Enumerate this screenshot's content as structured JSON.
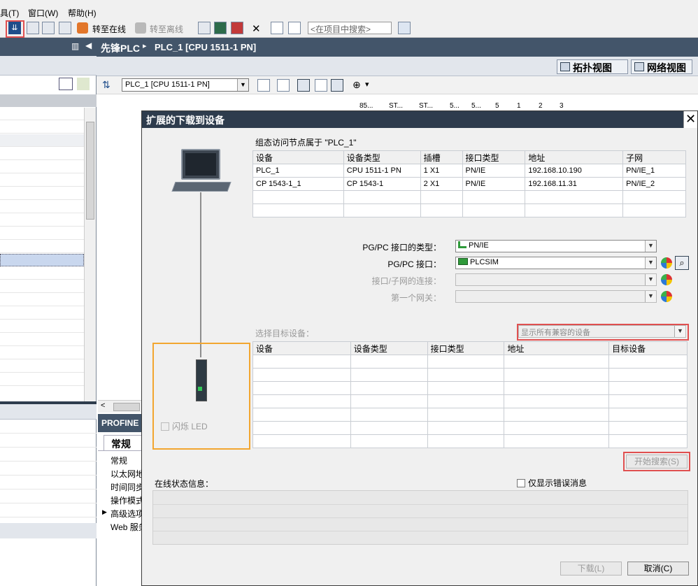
{
  "menu": {
    "tools": "具(T)",
    "window": "窗口(W)",
    "help": "帮助(H)"
  },
  "toolbar": {
    "go_online": "转至在线",
    "go_offline": "转至离线",
    "search_placeholder": "<在项目中搜索>"
  },
  "breadcrumb": {
    "project": "先锋PLC",
    "separator": "▸",
    "device": "PLC_1 [CPU 1511-1 PN]"
  },
  "views": {
    "topology": "拓扑视图",
    "network": "网络视图"
  },
  "device_select": "PLC_1 [CPU 1511-1 PN]",
  "rack_labels": [
    "85...",
    "ST...",
    "ST...",
    "5...",
    "5...",
    "5",
    "1",
    "2",
    "3"
  ],
  "inspector": {
    "tab_title": "PROFINE",
    "general_tab": "常规",
    "items": [
      "常规",
      "以太网地",
      "时间同步",
      "操作模式",
      "高级选项",
      "Web 服务"
    ]
  },
  "dialog": {
    "title": "扩展的下载到设备",
    "close": "✕",
    "configured_label": "组态访问节点属于 \"PLC_1\"",
    "configured_table": {
      "headers": [
        "设备",
        "设备类型",
        "插槽",
        "接口类型",
        "地址",
        "子网"
      ],
      "rows": [
        [
          "PLC_1",
          "CPU 1511-1 PN",
          "1 X1",
          "PN/IE",
          "192.168.10.190",
          "PN/IE_1"
        ],
        [
          "CP 1543-1_1",
          "CP 1543-1",
          "2 X1",
          "PN/IE",
          "192.168.11.31",
          "PN/IE_2"
        ]
      ]
    },
    "pgpc_if_type_label": "PG/PC 接口的类型：",
    "pgpc_if_type_value": "PN/IE",
    "pgpc_if_label": "PG/PC 接口：",
    "pgpc_if_value": "PLCSIM",
    "subnet_conn_label": "接口/子网的连接：",
    "gateway_label": "第一个网关：",
    "select_target_label": "选择目标设备：",
    "show_devices_value": "显示所有兼容的设备",
    "target_table": {
      "headers": [
        "设备",
        "设备类型",
        "接口类型",
        "地址",
        "目标设备"
      ]
    },
    "flash_led": "闪烁 LED",
    "start_search": "开始搜索(S)",
    "online_status_label": "在线状态信息：",
    "only_errors": "仅显示错误消息",
    "load_button": "下载(L)",
    "cancel_button": "取消(C)"
  },
  "colors": {
    "title_bar": "#2e3c4d",
    "breadcrumb_bar": "#43556a",
    "highlight_red": "#e05050",
    "highlight_orange": "#f2a630",
    "pnie_green": "#2f9a3a"
  }
}
